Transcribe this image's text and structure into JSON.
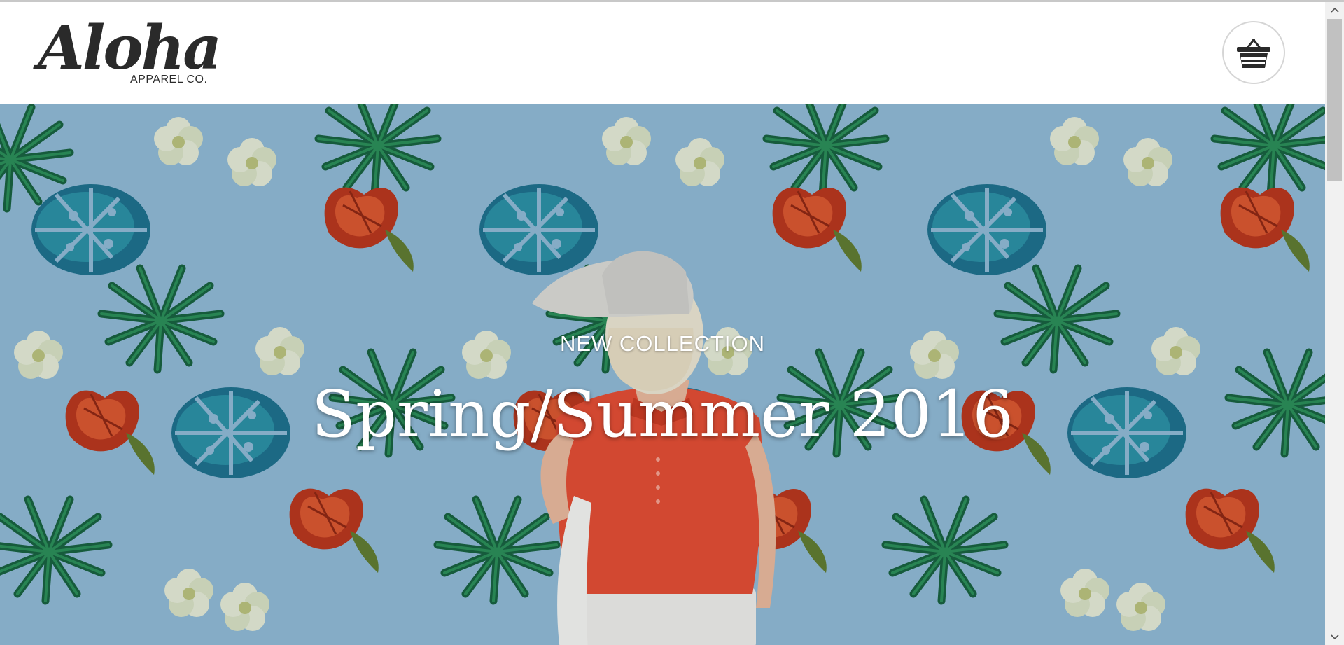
{
  "header": {
    "logo": {
      "script_text": "Aloha",
      "sub_text": "APPAREL CO."
    },
    "cart": {
      "icon": "basket-icon"
    }
  },
  "hero": {
    "eyebrow": "NEW COLLECTION",
    "title": "Spring/Summer 2016",
    "background": "tropical-floral-pattern-with-model"
  },
  "scrollbar": {
    "position_fraction": 0.0
  },
  "colors": {
    "text_dark": "#2a2a2a",
    "hero_bg": "#8fb8d2",
    "leaf_green": "#1f7a4a",
    "leaf_teal": "#1f6f86",
    "flower_red": "#c9401e",
    "flower_cream": "#dfe6cf",
    "shirt_red": "#e24b30"
  }
}
